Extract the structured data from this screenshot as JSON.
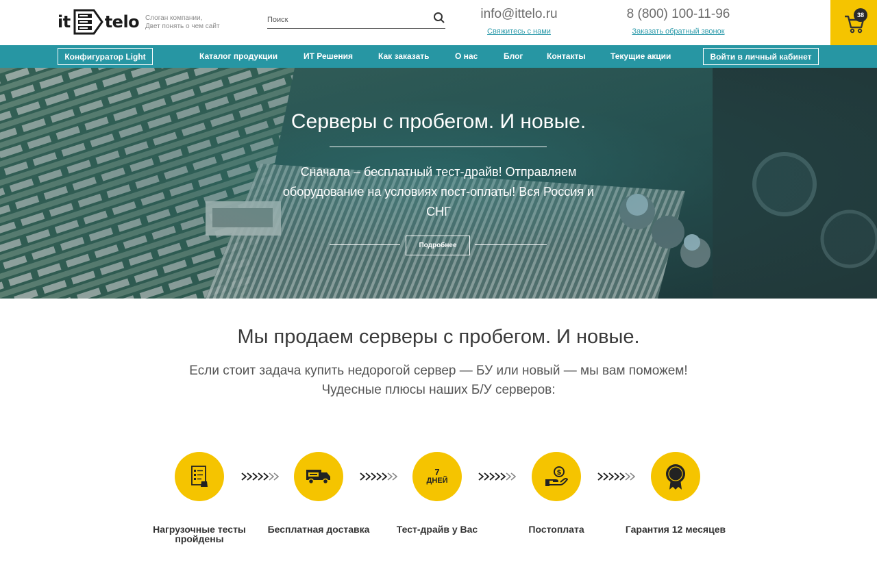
{
  "header": {
    "logo": {
      "left": "it",
      "right": "telo"
    },
    "slogan": [
      "Слоган компании,",
      "Двет понять о чем сайт"
    ],
    "search": {
      "placeholder": "Поиск"
    },
    "email": {
      "value": "info@ittelo.ru",
      "link": "Свяжитесь с нами"
    },
    "phone": {
      "value": "8 (800) 100-11-96",
      "link": "Заказать обратный звонок"
    },
    "cart": {
      "count": "38"
    }
  },
  "nav": {
    "configurator": "Конфигуратор Light",
    "items": [
      "Каталог продукции",
      "ИТ Решения",
      "Как заказать",
      "О нас",
      "Блог",
      "Контакты",
      "Текущие акции"
    ],
    "cabinet": "Войти в личный кабинет"
  },
  "hero": {
    "title": "Серверы с пробегом. И новые.",
    "text": "Сначала – бесплатный тест-драйв! Отправляем оборудование на условиях пост-оплаты! Вся Россия и СНГ",
    "button": "Подробнее"
  },
  "main": {
    "title": "Мы продаем серверы с пробегом. И новые.",
    "subtitle_1": "Если стоит задача купить недорогой сервер — БУ или новый — мы вам поможем!",
    "subtitle_2": "Чудесные плюсы наших Б/У серверов:"
  },
  "features": [
    {
      "icon": "checklist-icon",
      "label": "Нагрузочные тесты пройдены"
    },
    {
      "icon": "free-truck-icon",
      "label": "Бесплатная доставка"
    },
    {
      "icon": "7-days-icon",
      "number": "7",
      "unit": "ДНЕЙ",
      "label": "Тест-драйв у Вас"
    },
    {
      "icon": "hand-money-icon",
      "label": "Постоплата"
    },
    {
      "icon": "medal-icon",
      "label": "Гарантия 12 месяцев"
    }
  ],
  "colors": {
    "accent": "#f5c400",
    "nav": "#2796a3",
    "link": "#2b9aaa"
  }
}
